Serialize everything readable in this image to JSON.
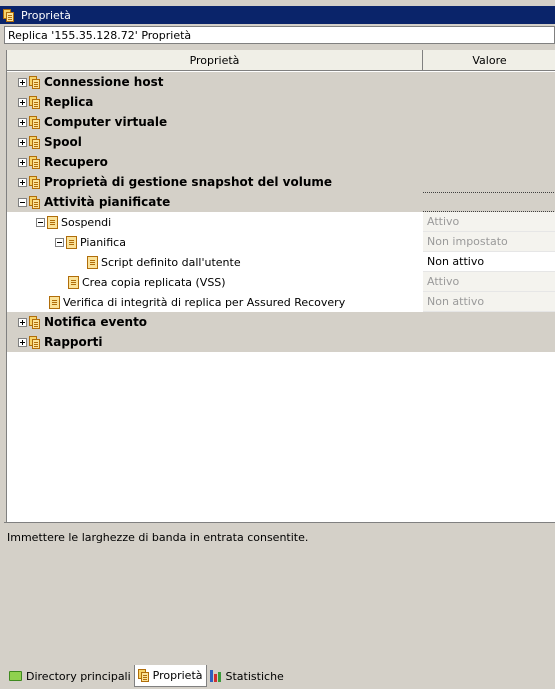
{
  "window": {
    "title": "Proprietà"
  },
  "header": {
    "path": "Replica  '155.35.128.72' Proprietà"
  },
  "grid": {
    "col_name": "Proprietà",
    "col_value": "Valore",
    "rows": [
      {
        "label": "Connessione host",
        "value": ""
      },
      {
        "label": "Replica",
        "value": ""
      },
      {
        "label": "Computer virtuale",
        "value": ""
      },
      {
        "label": "Spool",
        "value": ""
      },
      {
        "label": "Recupero",
        "value": ""
      },
      {
        "label": "Proprietà di gestione snapshot del volume",
        "value": ""
      },
      {
        "label": "Attività pianificate",
        "value": ""
      },
      {
        "label": "Sospendi",
        "value": "Attivo"
      },
      {
        "label": "Pianifica",
        "value": "Non impostato"
      },
      {
        "label": "Script definito dall'utente",
        "value": "Non attivo"
      },
      {
        "label": "Crea copia replicata (VSS)",
        "value": "Attivo"
      },
      {
        "label": "Verifica di integrità di replica per Assured Recovery",
        "value": "Non attivo"
      },
      {
        "label": "Notifica evento",
        "value": ""
      },
      {
        "label": "Rapporti",
        "value": ""
      }
    ]
  },
  "description": {
    "text": "Immettere le larghezze di banda in entrata consentite."
  },
  "tabs": [
    {
      "label": "Directory principali",
      "icon": "folder-icon"
    },
    {
      "label": "Proprietà",
      "icon": "properties-icon"
    },
    {
      "label": "Statistiche",
      "icon": "chart-icon"
    }
  ]
}
